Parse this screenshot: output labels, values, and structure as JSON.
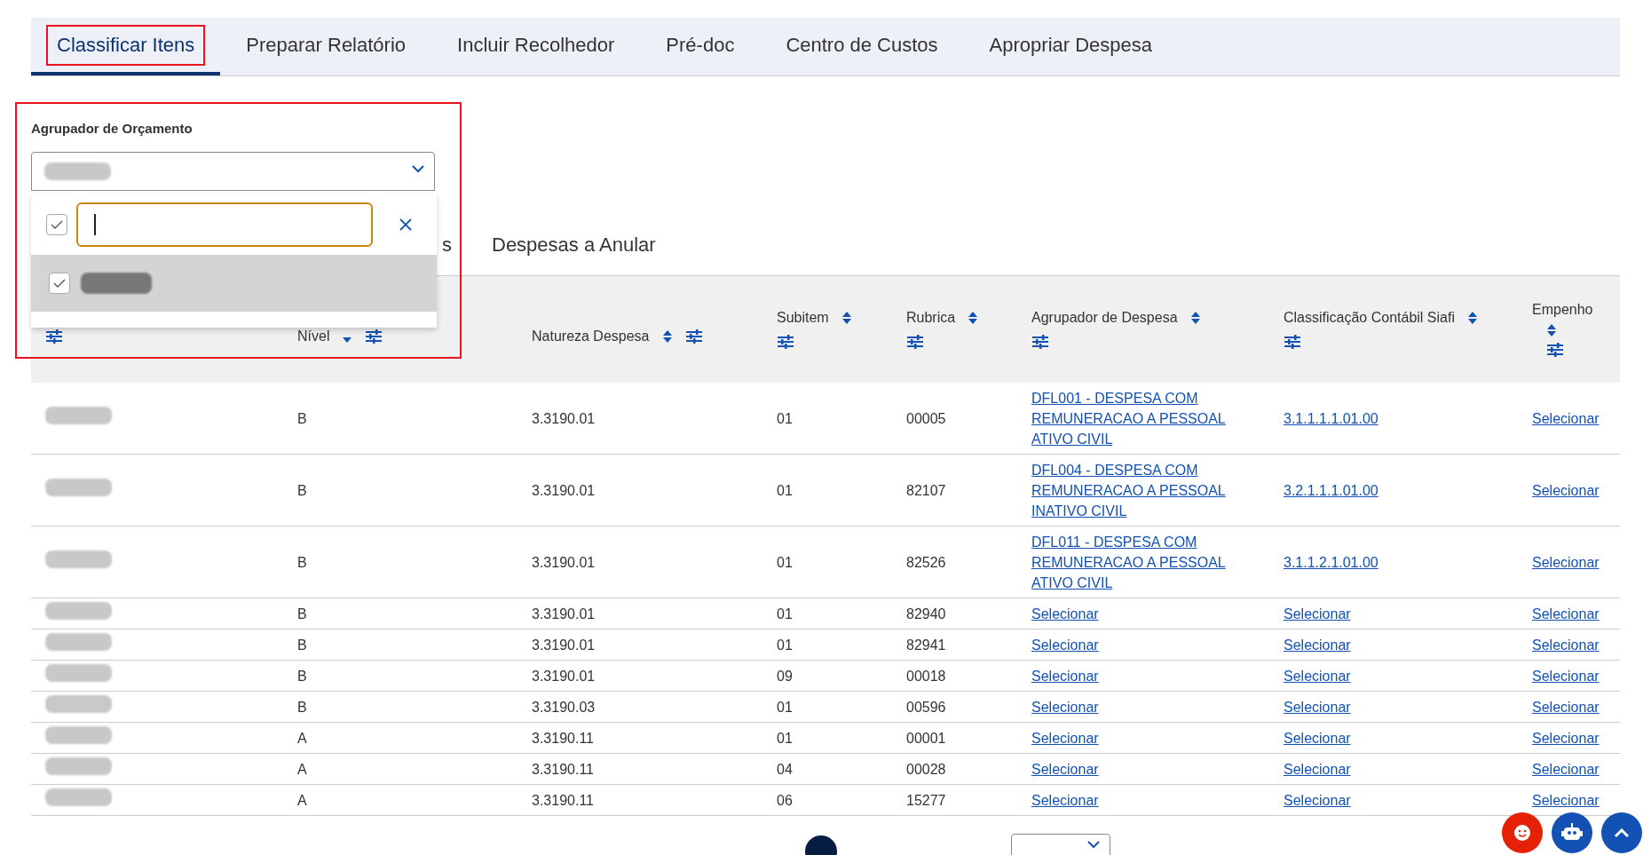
{
  "tabs": [
    {
      "label": "Classificar Itens",
      "selected": true,
      "highlighted": true
    },
    {
      "label": "Preparar Relatório",
      "selected": false,
      "highlighted": false
    },
    {
      "label": "Incluir Recolhedor",
      "selected": false,
      "highlighted": false
    },
    {
      "label": "Pré-doc",
      "selected": false,
      "highlighted": false
    },
    {
      "label": "Centro de Custos",
      "selected": false,
      "highlighted": false
    },
    {
      "label": "Apropriar Despesa",
      "selected": false,
      "highlighted": false
    }
  ],
  "filter": {
    "label": "Agrupador de Orçamento",
    "expanded": true,
    "highlighted": true,
    "select_all_checked": true,
    "options": [
      {
        "checked": true,
        "selected": true
      }
    ]
  },
  "subtabs": [
    {
      "label": "s"
    },
    {
      "label": "Despesas a Anular"
    }
  ],
  "table": {
    "columns": [
      {
        "label": "Nível",
        "kind": "text",
        "sort_desc": true
      },
      {
        "label": "Natureza Despesa",
        "kind": "text",
        "sort_desc": false
      },
      {
        "label": "Subitem",
        "kind": "text",
        "sort_desc": false
      },
      {
        "label": "Rubrica",
        "kind": "text",
        "sort_desc": false
      },
      {
        "label": "Agrupador de Despesa",
        "kind": "link",
        "sort_desc": false
      },
      {
        "label": "Classificação Contábil Siafi",
        "kind": "link",
        "sort_desc": false
      },
      {
        "label": "Empenho",
        "kind": "link",
        "sort_desc": false
      }
    ],
    "rows": [
      {
        "cells": [
          "B",
          "3.3190.01",
          "01",
          "00005",
          "DFL001 - DESPESA COM REMUNERACAO A PESSOAL ATIVO CIVIL",
          "3.1.1.1.1.01.00",
          "Selecionar"
        ]
      },
      {
        "cells": [
          "B",
          "3.3190.01",
          "01",
          "82107",
          "DFL004 - DESPESA COM REMUNERACAO A PESSOAL INATIVO CIVIL",
          "3.2.1.1.1.01.00",
          "Selecionar"
        ]
      },
      {
        "cells": [
          "B",
          "3.3190.01",
          "01",
          "82526",
          "DFL011 - DESPESA COM REMUNERACAO A PESSOAL ATIVO CIVIL",
          "3.1.1.2.1.01.00",
          "Selecionar"
        ]
      },
      {
        "cells": [
          "B",
          "3.3190.01",
          "01",
          "82940",
          "Selecionar",
          "Selecionar",
          "Selecionar"
        ]
      },
      {
        "cells": [
          "B",
          "3.3190.01",
          "01",
          "82941",
          "Selecionar",
          "Selecionar",
          "Selecionar"
        ]
      },
      {
        "cells": [
          "B",
          "3.3190.01",
          "09",
          "00018",
          "Selecionar",
          "Selecionar",
          "Selecionar"
        ]
      },
      {
        "cells": [
          "B",
          "3.3190.03",
          "01",
          "00596",
          "Selecionar",
          "Selecionar",
          "Selecionar"
        ]
      },
      {
        "cells": [
          "A",
          "3.3190.11",
          "01",
          "00001",
          "Selecionar",
          "Selecionar",
          "Selecionar"
        ]
      },
      {
        "cells": [
          "A",
          "3.3190.11",
          "04",
          "00028",
          "Selecionar",
          "Selecionar",
          "Selecionar"
        ]
      },
      {
        "cells": [
          "A",
          "3.3190.11",
          "06",
          "15277",
          "Selecionar",
          "Selecionar",
          "Selecionar"
        ]
      }
    ]
  }
}
